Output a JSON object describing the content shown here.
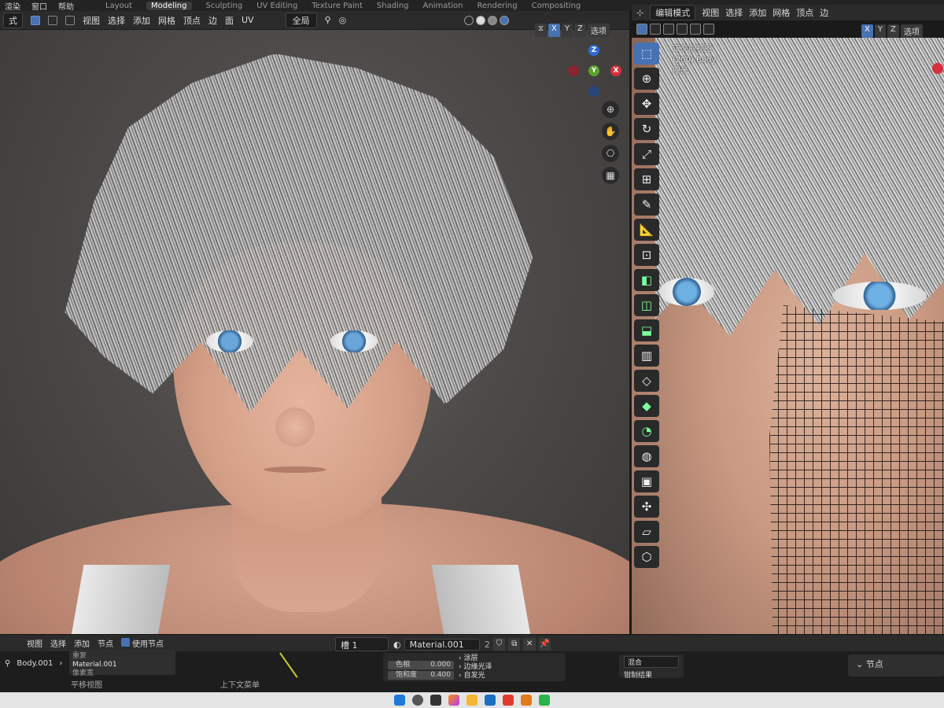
{
  "topbar": {
    "menus": [
      "渲染",
      "窗口",
      "帮助"
    ],
    "tabs": [
      "Layout",
      "Modeling",
      "Sculpting",
      "UV Editing",
      "Texture Paint",
      "Shading",
      "Animation",
      "Rendering",
      "Compositing"
    ],
    "active_tab": "Modeling"
  },
  "left_header": {
    "mode": "式",
    "menus": [
      "视图",
      "选择",
      "添加",
      "网格",
      "顶点",
      "边",
      "面",
      "UV"
    ],
    "orientation": "全局",
    "axes": [
      "X",
      "Y",
      "Z"
    ],
    "options": "选项"
  },
  "gizmo": {
    "z": "Z",
    "y": "Y",
    "x": "X"
  },
  "navicons": [
    "zoom-icon",
    "hand-icon",
    "camera-icon",
    "grid-icon"
  ],
  "right_header": {
    "mode": "编辑模式",
    "menus": [
      "视图",
      "选择",
      "添加",
      "网格",
      "顶点",
      "边"
    ],
    "axes": [
      "X",
      "Y",
      "Z"
    ],
    "options": "选项"
  },
  "right_info": {
    "line1": "正交前视图",
    "line2": "(200) Body",
    "line3": "厘米"
  },
  "tools": [
    "select",
    "cursor",
    "move",
    "rotate",
    "scale",
    "transform",
    "annotate",
    "measure",
    "add-cube",
    "extrude",
    "inset",
    "bevel",
    "loop-cut",
    "knife",
    "poly-build",
    "spin",
    "smooth",
    "edge-slide",
    "shrink-fatten",
    "shear",
    "rip"
  ],
  "node_bar": {
    "menus": [
      "视图",
      "选择",
      "添加",
      "节点"
    ],
    "use_nodes": "使用节点",
    "slot": "槽 1",
    "material": "Material.001",
    "users": "2"
  },
  "node_area": {
    "object": "Body.001",
    "material": "Material.001",
    "mat_rows": [
      "重复",
      "像素宽"
    ],
    "props": [
      {
        "label": "色相",
        "value": "0.000"
      },
      {
        "label": "饱和度",
        "value": "0.400"
      }
    ],
    "prop_list": [
      "涂层",
      "边缘光泽",
      "自发光"
    ],
    "mix_mode": "混合",
    "clamp": "钳制结果",
    "node_panel": "节点",
    "status_left": "平移视图",
    "status_right": "上下文菜单"
  },
  "colors": {
    "accent": "#4772b3",
    "axis_x": "#d6303c",
    "axis_y": "#5aa12c",
    "axis_z": "#2f6bd6"
  }
}
